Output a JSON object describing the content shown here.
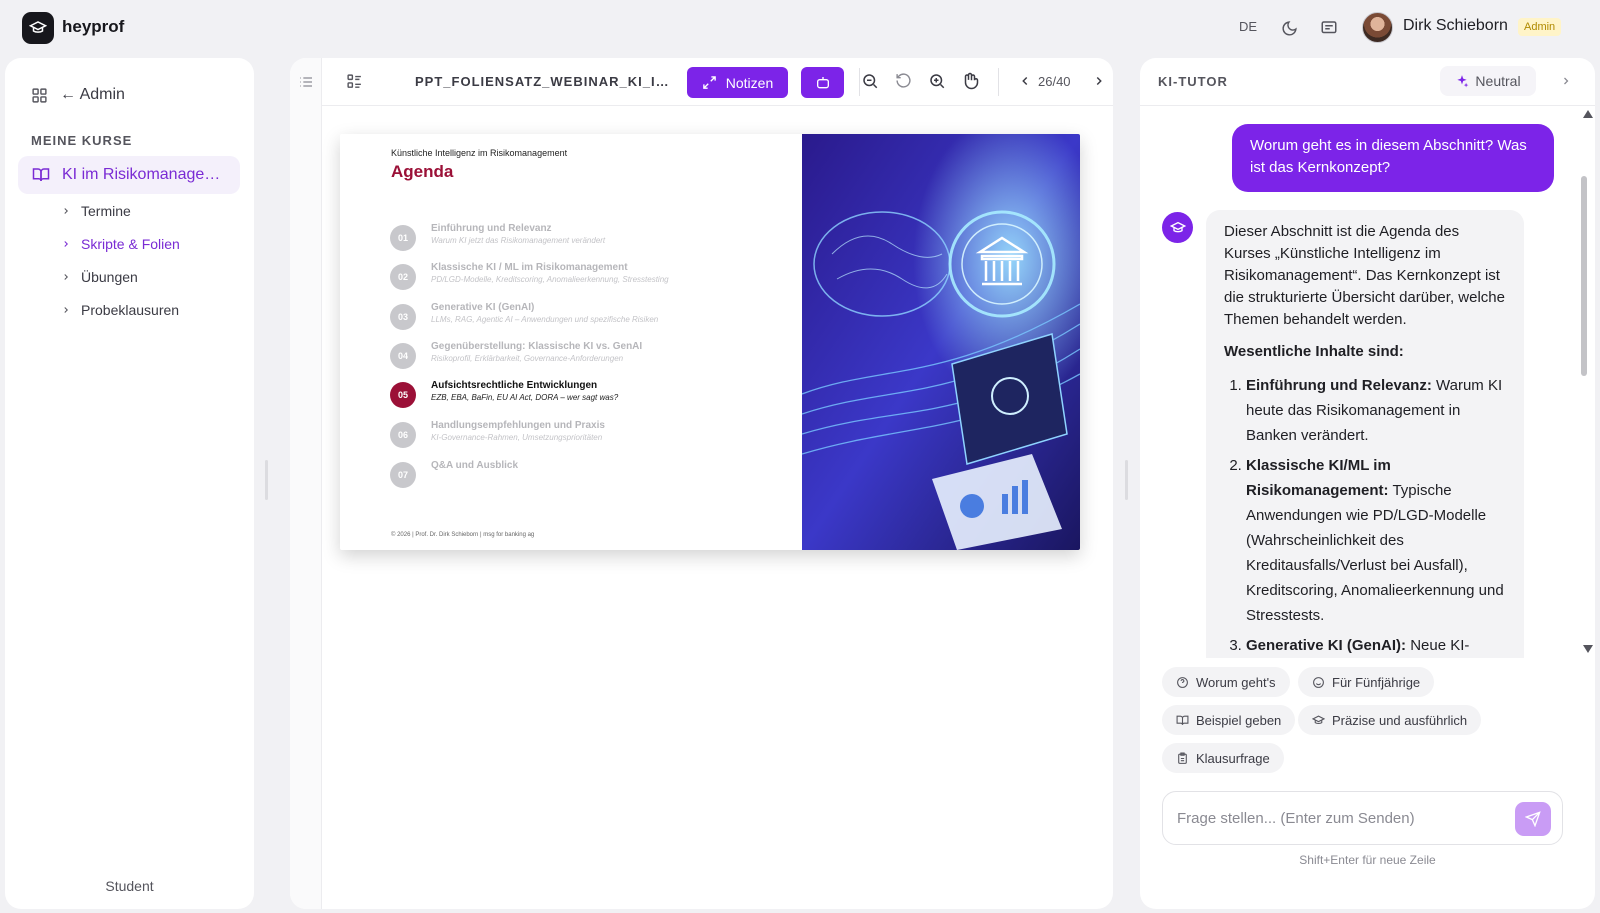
{
  "app": {
    "brand": "heyprof"
  },
  "topbar": {
    "lang": "DE",
    "user_name": "Dirk Schieborn",
    "role_badge": "Admin"
  },
  "sidebar": {
    "back_label": "← Admin",
    "section": "MEINE KURSE",
    "course": "KI im Risikomanagement",
    "items": [
      {
        "label": "Termine",
        "active": false
      },
      {
        "label": "Skripte & Folien",
        "active": true
      },
      {
        "label": "Übungen",
        "active": false
      },
      {
        "label": "Probeklausuren",
        "active": false
      }
    ],
    "footer_role": "Student"
  },
  "viewer": {
    "filename": "PPT_FOLIENSATZ_WEBINAR_KI_IM_RISIKOMANAGEMENT",
    "notes_label": "Notizen",
    "page_indicator": "26/40"
  },
  "slide": {
    "kicker": "Künstliche Intelligenz im Risikomanagement",
    "title": "Agenda",
    "items": [
      {
        "num": "01",
        "title": "Einführung und Relevanz",
        "sub": "Warum KI jetzt das Risikomanagement verändert",
        "active": false
      },
      {
        "num": "02",
        "title": "Klassische KI / ML im Risikomanagement",
        "sub": "PD/LGD-Modelle, Kreditscoring, Anomalieerkennung, Stresstesting",
        "active": false
      },
      {
        "num": "03",
        "title": "Generative KI (GenAI)",
        "sub": "LLMs, RAG, Agentic AI – Anwendungen und spezifische Risiken",
        "active": false
      },
      {
        "num": "04",
        "title": "Gegenüberstellung: Klassische KI vs. GenAI",
        "sub": "Risikoprofil, Erklärbarkeit, Governance-Anforderungen",
        "active": false
      },
      {
        "num": "05",
        "title": "Aufsichtsrechtliche Entwicklungen",
        "sub": "EZB, EBA, BaFin, EU AI Act, DORA – wer sagt was?",
        "active": true
      },
      {
        "num": "06",
        "title": "Handlungsempfehlungen und Praxis",
        "sub": "KI-Governance-Rahmen, Umsetzungsprioritäten",
        "active": false
      },
      {
        "num": "07",
        "title": "Q&A und Ausblick",
        "sub": "",
        "active": false
      }
    ],
    "footer": "© 2026 | Prof. Dr. Dirk Schieborn | msg for banking ag"
  },
  "tutor": {
    "title": "KI-TUTOR",
    "mode": "Neutral",
    "user_message": "Worum geht es in diesem Abschnitt? Was ist das Kernkonzept?",
    "bot": {
      "intro": "Dieser Abschnitt ist die Agenda des Kurses „Künstliche Intelligenz im Risikomanagement“. Das Kernkonzept ist die strukturierte Übersicht darüber, welche Themen behandelt werden.",
      "heading": "Wesentliche Inhalte sind:",
      "points": [
        {
          "bold": "Einführung und Relevanz:",
          "text": " Warum KI heute das Risikomanagement in Banken verändert."
        },
        {
          "bold": "Klassische KI/ML im Risikomanagement:",
          "text": " Typische Anwendungen wie PD/LGD-Modelle (Wahrscheinlichkeit des Kreditausfalls/Verlust bei Ausfall), Kreditscoring, Anomalieerkennung und Stresstests."
        },
        {
          "bold": "Generative KI (GenAI):",
          "text": " Neue KI-"
        }
      ]
    },
    "chips": [
      "Worum geht's",
      "Für Fünfjährige",
      "Beispiel geben",
      "Präzise und ausführlich",
      "Klausurfrage"
    ],
    "input_placeholder": "Frage stellen... (Enter zum Senden)",
    "hint": "Shift+Enter für neue Zeile"
  }
}
